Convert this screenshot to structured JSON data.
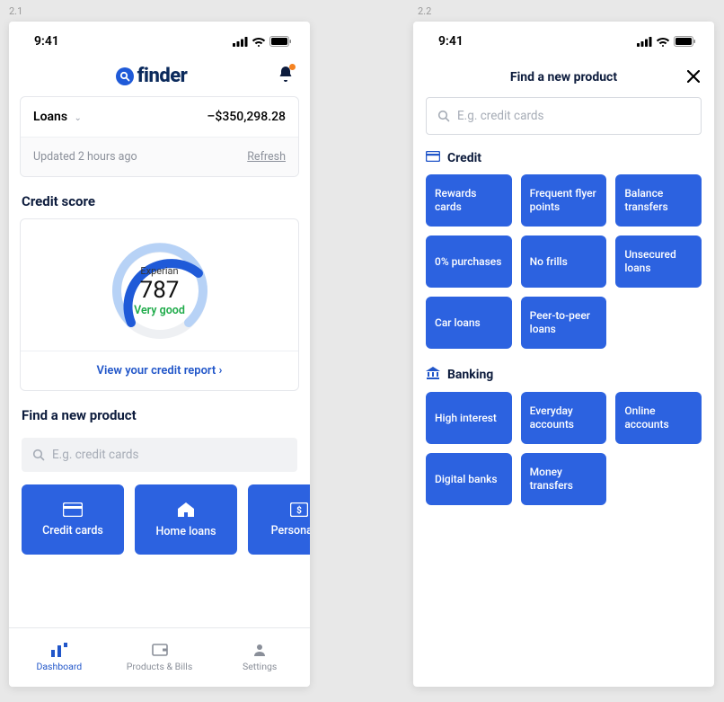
{
  "labels": {
    "s1": "2.1",
    "s2": "2.2"
  },
  "status": {
    "time": "9:41"
  },
  "brand": "finder",
  "loans": {
    "label": "Loans",
    "amount": "–$350,298.28",
    "updated": "Updated 2 hours ago",
    "refresh": "Refresh"
  },
  "credit": {
    "title": "Credit score",
    "provider": "Experian",
    "score": "787",
    "rating": "Very good",
    "cta": "View your credit report  ›"
  },
  "find": {
    "title": "Find a new product",
    "placeholder": "E.g. credit cards"
  },
  "tiles": [
    {
      "label": "Credit cards",
      "icon": "card"
    },
    {
      "label": "Home loans",
      "icon": "home"
    },
    {
      "label": "Personal lo",
      "icon": "dollar"
    }
  ],
  "tabs": [
    {
      "label": "Dashboard",
      "active": true
    },
    {
      "label": "Products & Bills",
      "active": false
    },
    {
      "label": "Settings",
      "active": false
    }
  ],
  "modal": {
    "title": "Find a new product",
    "placeholder": "E.g. credit cards"
  },
  "categories": [
    {
      "name": "Credit",
      "icon": "credit",
      "items": [
        "Rewards cards",
        "Frequent flyer points",
        "Balance transfers",
        "0% purchases",
        "No frills",
        "Unsecured loans",
        "Car loans",
        "Peer-to-peer loans"
      ]
    },
    {
      "name": "Banking",
      "icon": "bank",
      "items": [
        "High interest",
        "Everyday accounts",
        "Online accounts",
        "Digital banks",
        "Money transfers"
      ]
    }
  ]
}
